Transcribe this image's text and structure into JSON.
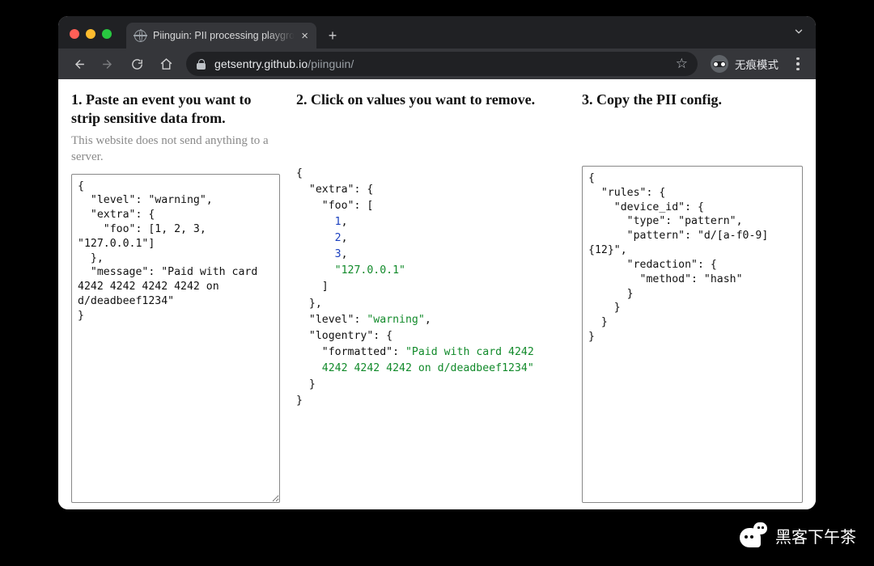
{
  "browser": {
    "tab_title": "Piinguin: PII processing playgro",
    "new_tab_label": "+",
    "close_label": "×",
    "url_host": "getsentry.github.io",
    "url_path": "/piinguin/",
    "incognito_label": "无痕模式"
  },
  "page": {
    "col1": {
      "heading": "1. Paste an event you want to strip sensitive data from.",
      "sub": "This website does not send anything to a server.",
      "textarea": "{\n  \"level\": \"warning\",\n  \"extra\": {\n    \"foo\": [1, 2, 3,\n\"127.0.0.1\"]\n  },\n  \"message\": \"Paid with card\n4242 4242 4242 4242 on\nd/deadbeef1234\"\n}"
    },
    "col2": {
      "heading": "2. Click on values you want to remove.",
      "json": {
        "l1": "{",
        "l2": "  \"extra\": {",
        "l3": "    \"foo\": [",
        "v1": "1",
        "v2": "2",
        "v3": "3",
        "vs": "\"127.0.0.1\"",
        "l4": "    ]",
        "l5": "  },",
        "l6_k": "  \"level\": ",
        "l6_v": "\"warning\"",
        "l7": "  \"logentry\": {",
        "l8_k": "    \"formatted\": ",
        "l8_v1": "\"Paid with card 4242",
        "l8_v2": "    4242 4242 4242 on d/deadbeef1234\"",
        "l9": "  }",
        "l10": "}"
      }
    },
    "col3": {
      "heading": "3. Copy the PII config.",
      "textarea": "{\n  \"rules\": {\n    \"device_id\": {\n      \"type\": \"pattern\",\n      \"pattern\": \"d/[a-f0-9]\n{12}\",\n      \"redaction\": {\n        \"method\": \"hash\"\n      }\n    }\n  }\n}"
    }
  },
  "watermark": {
    "text": "黑客下午茶"
  }
}
